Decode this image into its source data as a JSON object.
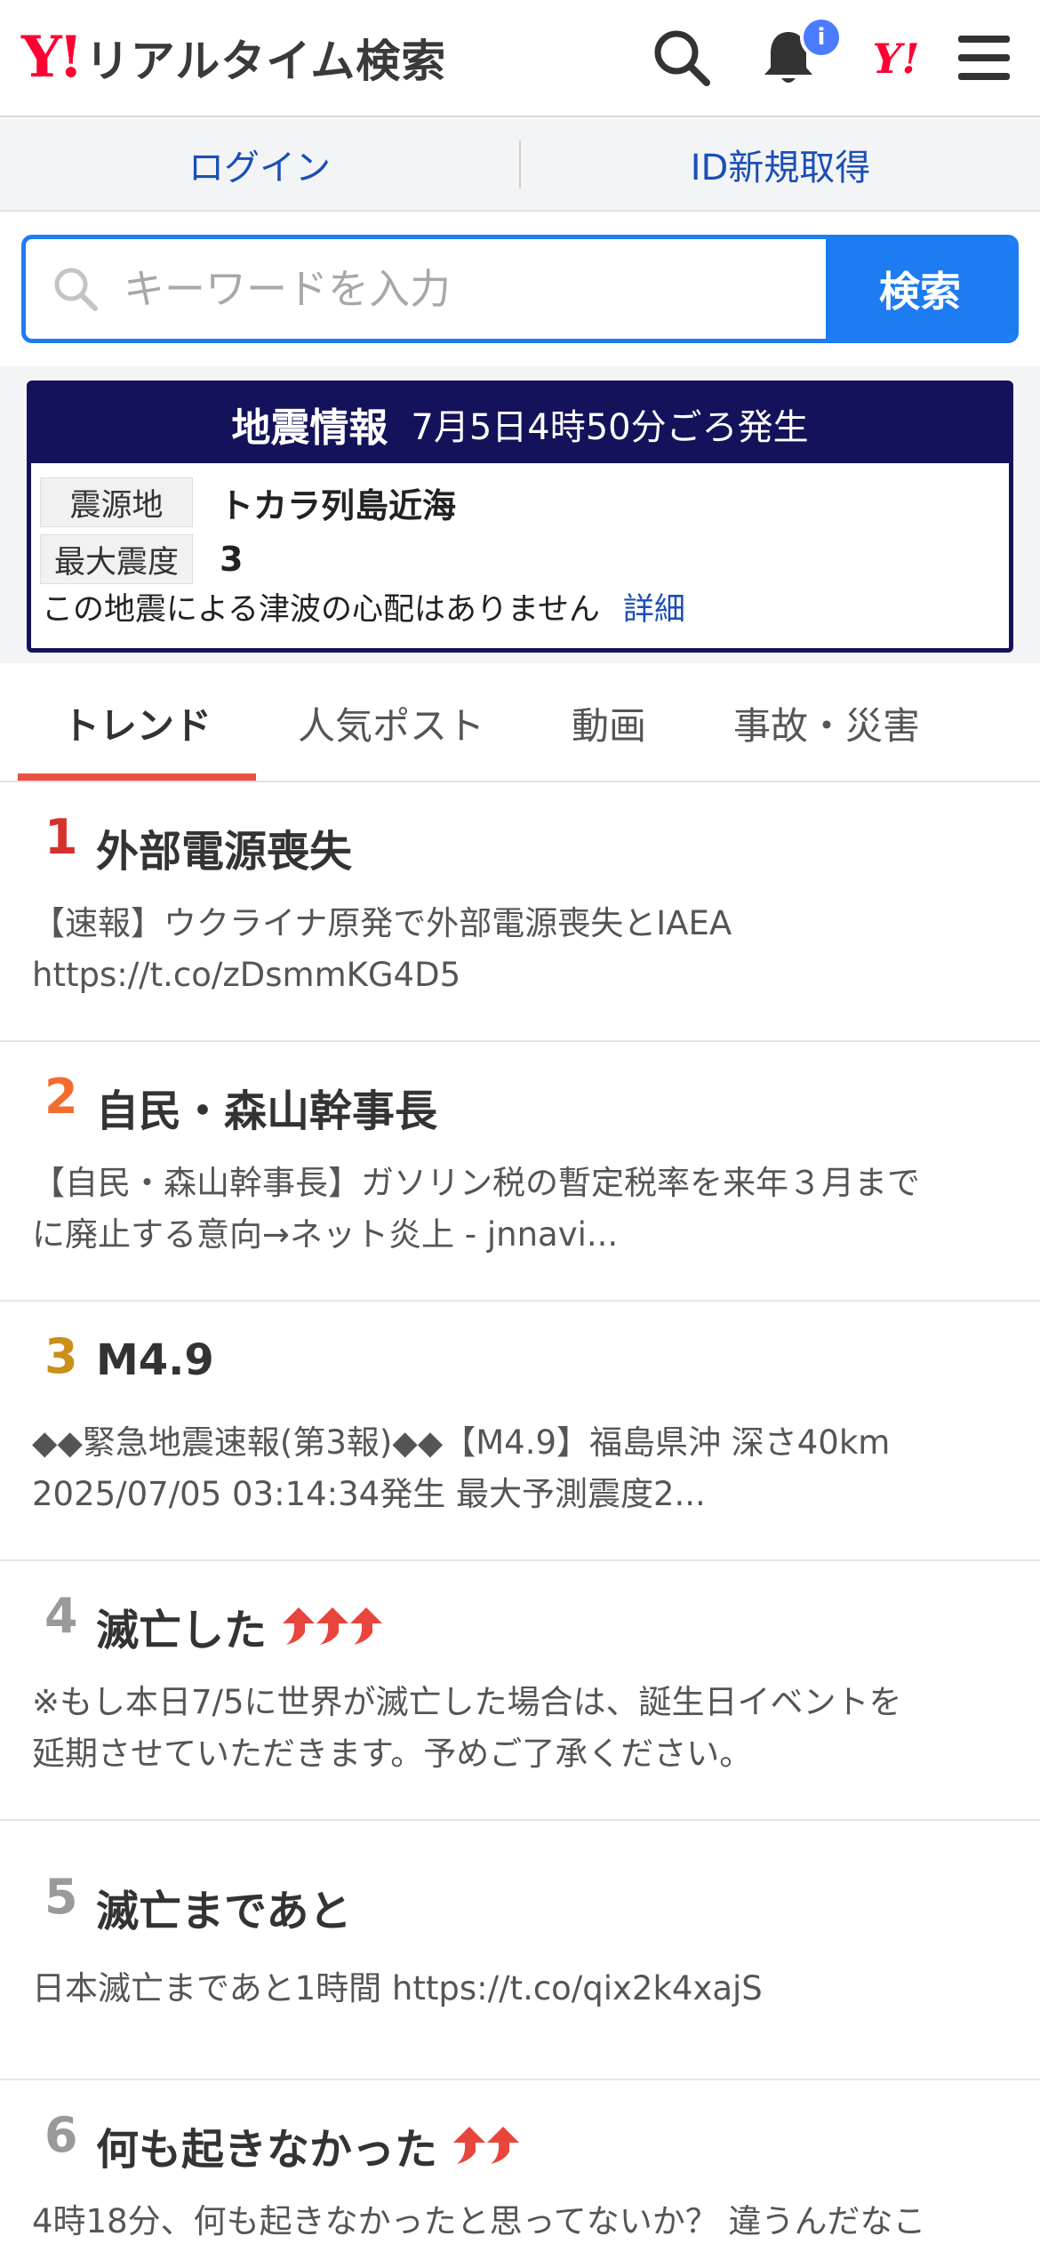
{
  "header": {
    "logo_mark": "Y!",
    "logo_text": "リアルタイム検索",
    "notification_badge": "i",
    "yahoo_icon_text": "Y!"
  },
  "loginbar": {
    "login": "ログイン",
    "signup": "ID新規取得"
  },
  "search": {
    "placeholder": "キーワードを入力",
    "button": "検索"
  },
  "earthquake": {
    "title": "地震情報",
    "time": "7月5日4時50分ごろ発生",
    "epicenter_label": "震源地",
    "epicenter_value": "トカラ列島近海",
    "intensity_label": "最大震度",
    "intensity_value": "3",
    "tsunami_note": "この地震による津波の心配はありません",
    "detail_link": "詳細",
    "header_color": "#14125a"
  },
  "tabs": [
    {
      "label": "トレンド",
      "active": true
    },
    {
      "label": "人気ポスト",
      "active": false
    },
    {
      "label": "動画",
      "active": false
    },
    {
      "label": "事故・災害",
      "active": false
    }
  ],
  "trends": [
    {
      "rank": "1",
      "term": "外部電源喪失",
      "arrows": 0,
      "rank_color": "#d6322c",
      "line1": "【速報】ウクライナ原発で外部電源喪失とIAEA",
      "line2": "https://t.co/zDsmmKG4D5"
    },
    {
      "rank": "2",
      "term": "自民・森山幹事長",
      "arrows": 0,
      "rank_color": "#f26b2f",
      "line1": "【自民・森山幹事長】ガソリン税の暫定税率を来年３月まで",
      "line2": "に廃止する意向→ネット炎上 - jnnavi..."
    },
    {
      "rank": "3",
      "term": "M4.9",
      "arrows": 0,
      "rank_color": "#c9901b",
      "line1": "◆◆緊急地震速報(第3報)◆◆【M4.9】福島県沖 深さ40km",
      "line2": "2025/07/05 03:14:34発生 最大予測震度2..."
    },
    {
      "rank": "4",
      "term": "滅亡した",
      "arrows": 3,
      "rank_color": "#9a9a9a",
      "line1": "※もし本日7/5に世界が滅亡した場合は、誕生日イベントを",
      "line2": "延期させていただきます。予めご了承ください。"
    },
    {
      "rank": "5",
      "term": "滅亡まであと",
      "arrows": 0,
      "rank_color": "#9a9a9a",
      "line1": "日本滅亡まであと1時間 https://t.co/qix2k4xajS",
      "line2": ""
    },
    {
      "rank": "6",
      "term": "何も起きなかった",
      "arrows": 2,
      "rank_color": "#9a9a9a",
      "line1": "4時18分、何も起きなかったと思ってないか？ 違うんだなこ",
      "line2": ""
    }
  ],
  "colors": {
    "accent_blue": "#1d7cf2",
    "link_blue": "#1a4fb5",
    "tab_underline": "#e8513f",
    "arrow_red": "#e8453c"
  }
}
